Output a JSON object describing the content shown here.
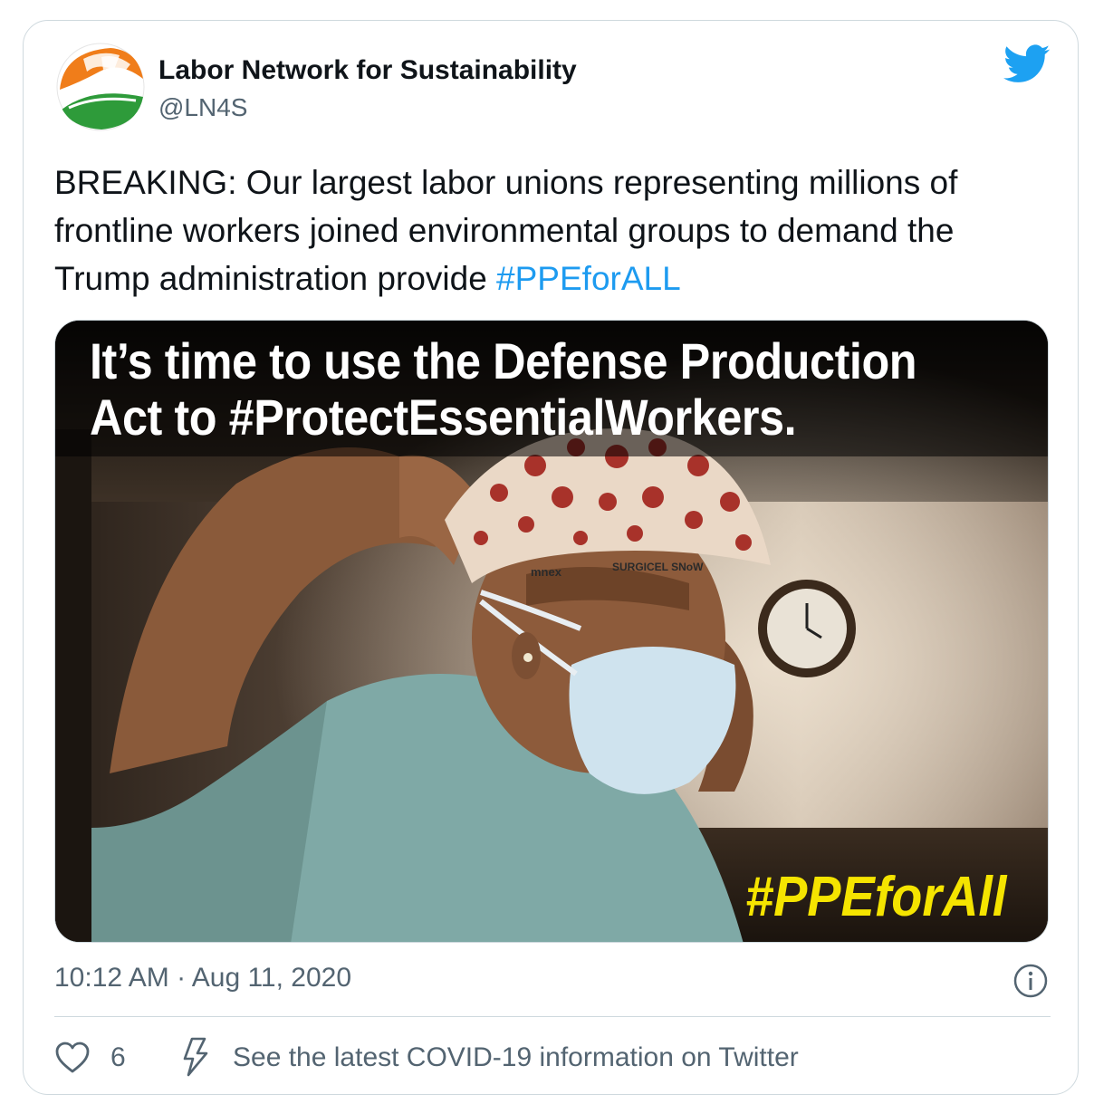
{
  "author": {
    "display_name": "Labor Network for Sustainability",
    "handle": "@LN4S",
    "avatar_icon": "ln4s-logo-icon"
  },
  "platform_icon": "twitter-bird-icon",
  "tweet": {
    "text": "BREAKING: Our largest labor unions representing millions of frontline workers joined environmental groups to demand the Trump administration provide ",
    "hashtag": "#PPEforALL"
  },
  "media": {
    "headline_line1": "It’s time to use the Defense Production",
    "headline_line2": "Act to #ProtectEssentialWorkers.",
    "hashtag": "#PPEforAll",
    "cap_text_1": "mnex",
    "cap_text_2": "SURGICEL SNoW"
  },
  "timestamp": "10:12 AM · Aug 11, 2020",
  "info_icon": "info-icon",
  "actions": {
    "like_icon": "heart-icon",
    "like_count": "6",
    "covid_icon": "lightning-bolt-icon",
    "covid_link": "See the latest COVID-19 information on Twitter"
  },
  "colors": {
    "link_blue": "#1d9bf0",
    "twitter_blue": "#1da1f2",
    "media_hashtag_yellow": "#f5e400",
    "secondary_text": "#536471"
  }
}
